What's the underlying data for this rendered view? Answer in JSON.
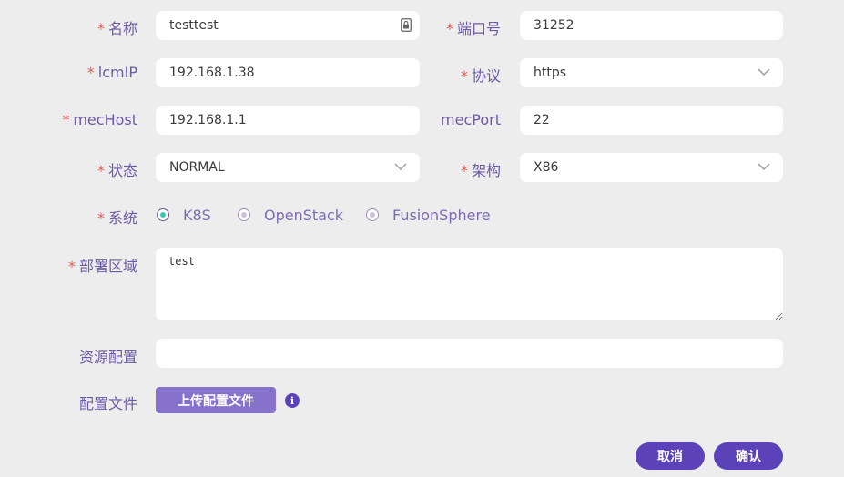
{
  "form": {
    "name": {
      "label": "名称",
      "required": "*",
      "value": "testtest"
    },
    "port": {
      "label": "端口号",
      "required": "*",
      "value": "31252"
    },
    "lcmip": {
      "label": "lcmIP",
      "required": "*",
      "value": "192.168.1.38"
    },
    "protocol": {
      "label": "协议",
      "required": "*",
      "value": "https"
    },
    "mechost": {
      "label": "mecHost",
      "required": "*",
      "value": "192.168.1.1"
    },
    "mecport": {
      "label": "mecPort",
      "value": "22"
    },
    "status": {
      "label": "状态",
      "required": "*",
      "value": "NORMAL"
    },
    "arch": {
      "label": "架构",
      "required": "*",
      "value": "X86"
    },
    "system": {
      "label": "系统",
      "required": "*",
      "options": [
        "K8S",
        "OpenStack",
        "FusionSphere"
      ],
      "selected": "K8S"
    },
    "region": {
      "label": "部署区域",
      "required": "*",
      "value": "test"
    },
    "resource": {
      "label": "资源配置",
      "value": ""
    },
    "config_file": {
      "label": "配置文件",
      "upload_label": "上传配置文件",
      "info_glyph": "i"
    }
  },
  "actions": {
    "cancel": "取消",
    "confirm": "确认"
  },
  "colors": {
    "accent": "#5b42b8",
    "upload": "#8671cc",
    "required": "#e05a5a",
    "label": "#6b5ba8",
    "radio_selected": "#3cc7b5"
  }
}
